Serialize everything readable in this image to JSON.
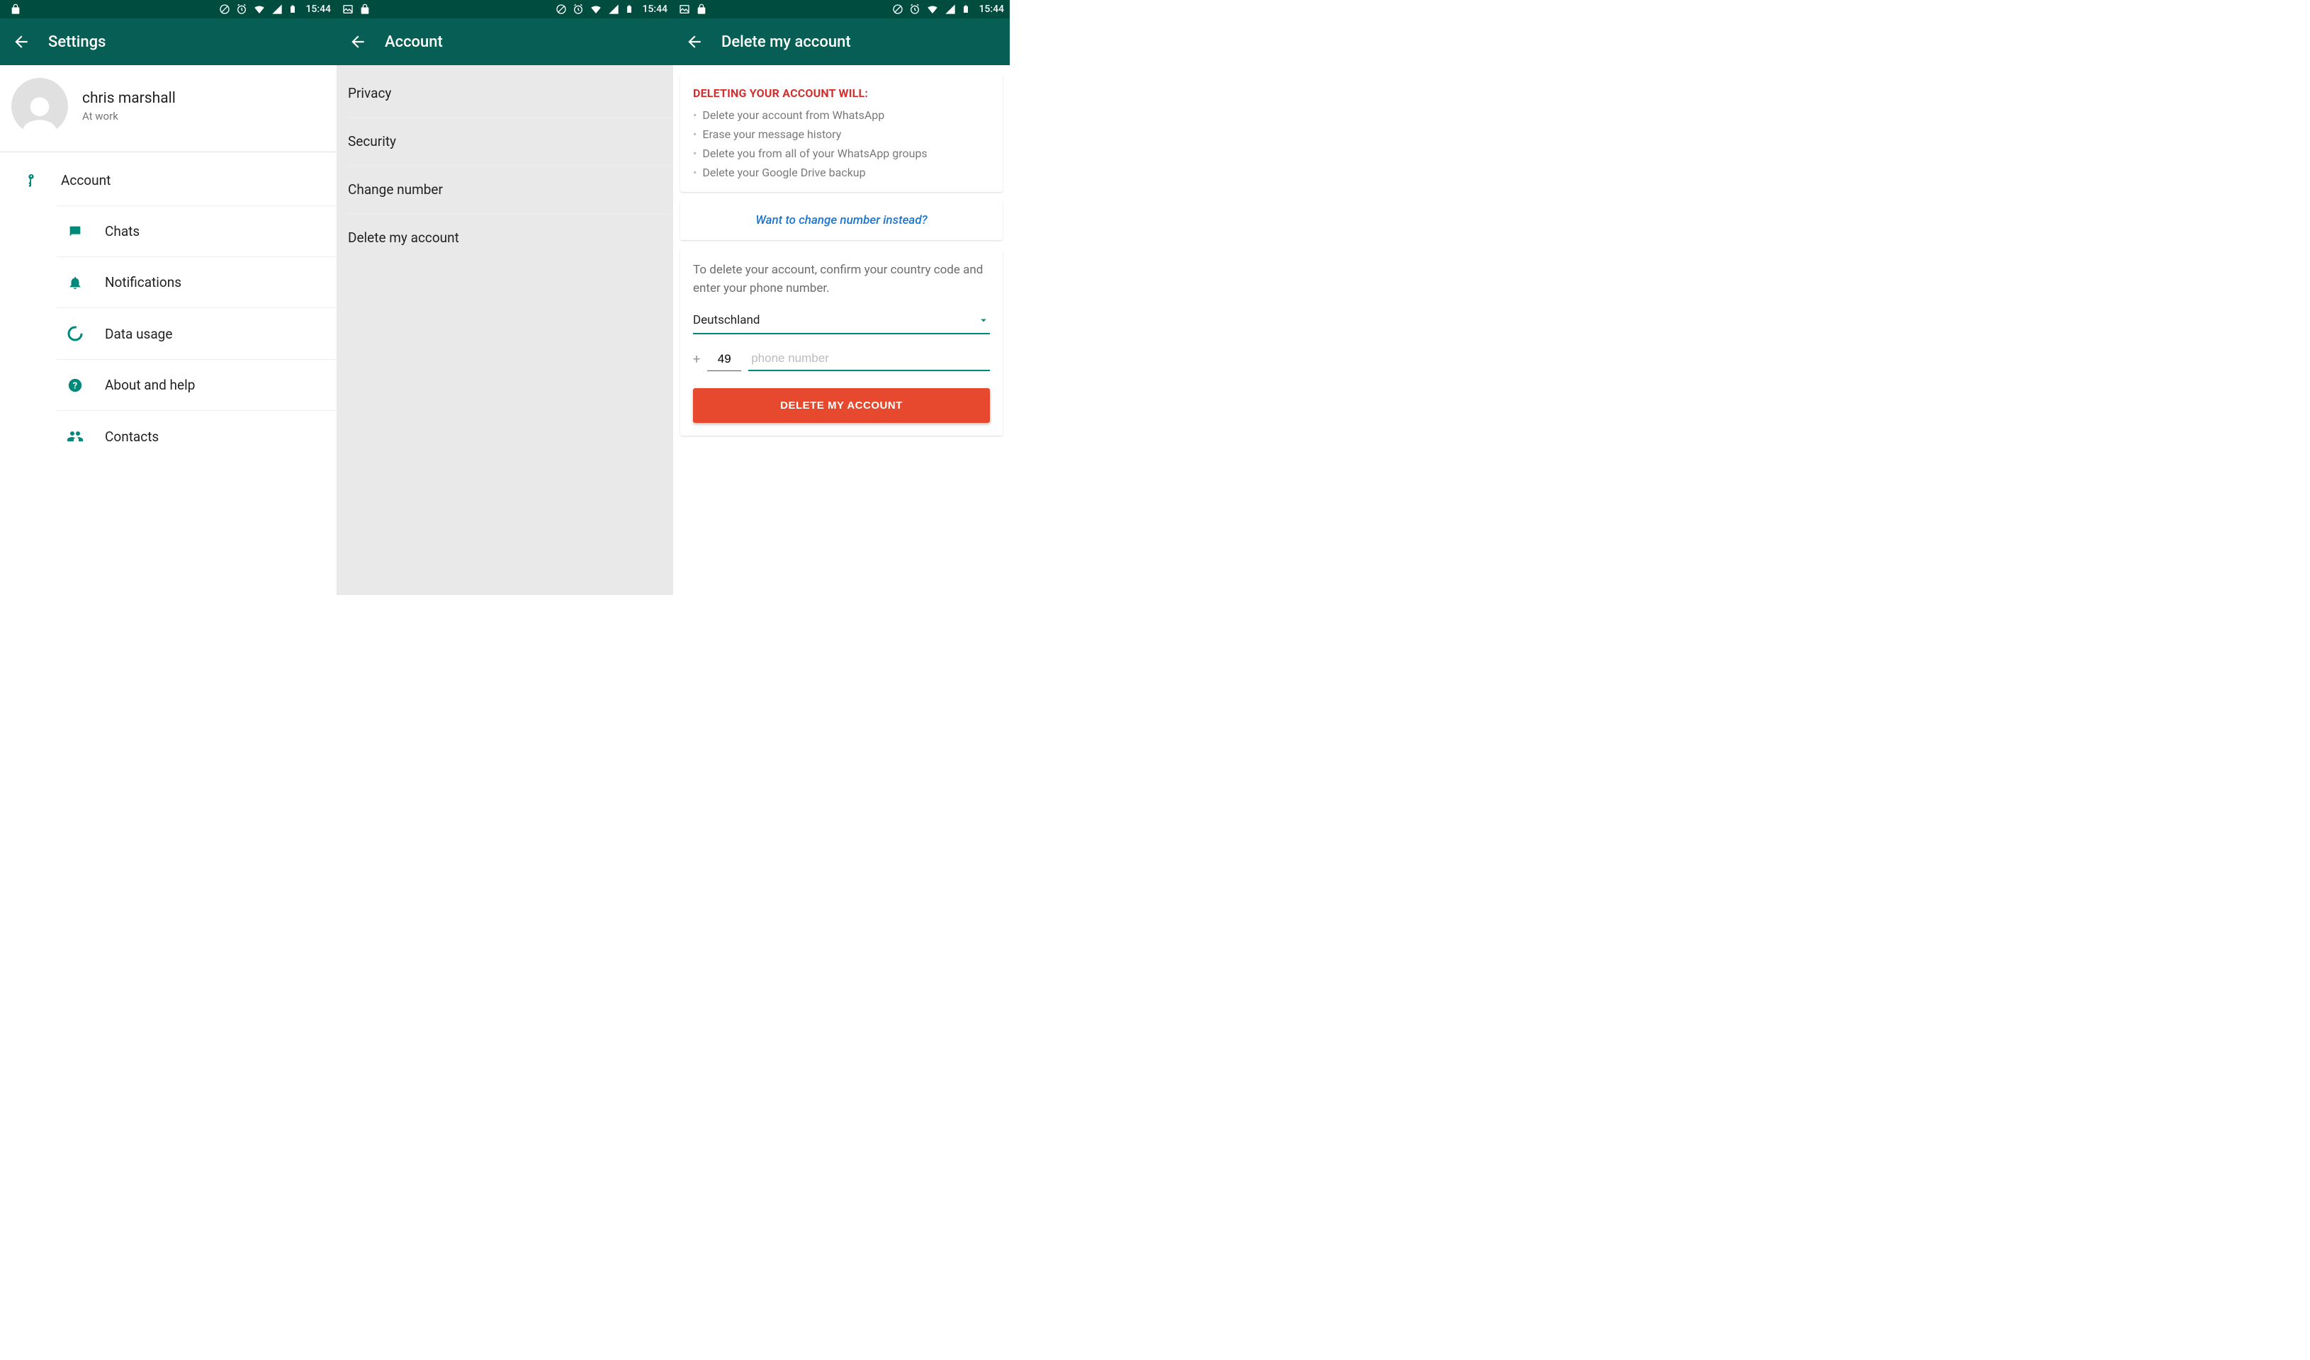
{
  "status": {
    "time": "15:44"
  },
  "screens": {
    "settings": {
      "title": "Settings",
      "profile": {
        "name": "chris marshall",
        "status": "At work"
      },
      "items": [
        {
          "label": "Account"
        },
        {
          "label": "Chats"
        },
        {
          "label": "Notifications"
        },
        {
          "label": "Data usage"
        },
        {
          "label": "About and help"
        },
        {
          "label": "Contacts"
        }
      ]
    },
    "account": {
      "title": "Account",
      "items": [
        {
          "label": "Privacy"
        },
        {
          "label": "Security"
        },
        {
          "label": "Change number"
        },
        {
          "label": "Delete my account"
        }
      ]
    },
    "delete": {
      "title": "Delete my account",
      "warning_heading": "DELETING YOUR ACCOUNT WILL:",
      "warning_items": [
        "Delete your account from WhatsApp",
        "Erase your message history",
        "Delete you from all of your WhatsApp groups",
        "Delete your Google Drive backup"
      ],
      "change_number_link": "Want to change number instead?",
      "confirm_instruction": "To delete your account, confirm your country code and enter your phone number.",
      "country": "Deutschland",
      "country_code": "49",
      "phone_placeholder": "phone number",
      "delete_button": "DELETE MY ACCOUNT"
    }
  }
}
